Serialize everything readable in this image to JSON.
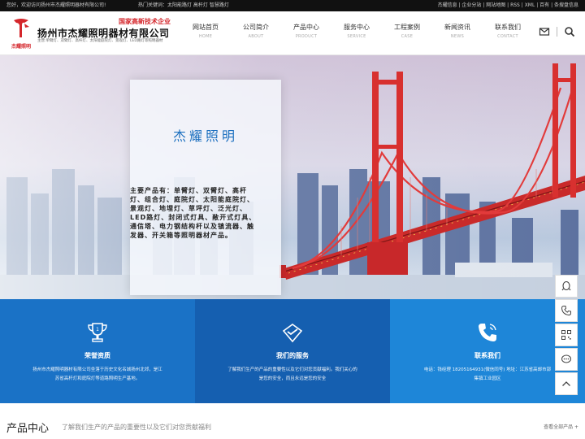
{
  "topbar": {
    "welcome": "您好，欢迎访问扬州市杰耀照明器材有限公司!",
    "hot_keywords": "热门关键词：太阳能路灯  高杆灯  智慧路灯",
    "links": "杰耀信息 | 企业分站 | 网站地图 | RSS | XML | 百有 | 条搜盘信息"
  },
  "header": {
    "logo_brand": "杰耀照明",
    "badge": "国家高新技术企业",
    "company_name": "扬州市杰耀照明器材有限公司",
    "products_line": "主营:单臂灯、双臂灯、高杆灯、太阳能庭院灯、景观灯、LED路灯等照明器材"
  },
  "nav": [
    {
      "cn": "网站首页",
      "en": "HOME"
    },
    {
      "cn": "公司简介",
      "en": "ABOUT"
    },
    {
      "cn": "产品中心",
      "en": "PRODUCT"
    },
    {
      "cn": "服务中心",
      "en": "SERVICE"
    },
    {
      "cn": "工程案例",
      "en": "CASE"
    },
    {
      "cn": "新闻资讯",
      "en": "NEWS"
    },
    {
      "cn": "联系我们",
      "en": "CONTACT"
    }
  ],
  "hero": {
    "title": "杰耀照明",
    "text": "主要产品有：单臂灯、双臂灯、高杆灯、组合灯、庭院灯、太阳能庭院灯、景观灯、地埋灯、草坪灯、泛光灯、LED路灯、封闭式灯具、敞开式灯具、通信塔、电力钢结构杆以及镇流器、触发器、开关箱等照明器材产品。"
  },
  "features": [
    {
      "icon": "trophy-icon",
      "title": "荣誉资质",
      "desc": "扬州市杰耀照明器材有限公司坐落于历史文化名城扬州北郊，是江苏省高杆灯和庭院灯等道路照明生产基地。"
    },
    {
      "icon": "handshake-icon",
      "title": "我们的服务",
      "desc": "了解我们生产的产品的重要性以及它们对您贡献福利。我们关心的是您的安全，而且永远是您的安全"
    },
    {
      "icon": "phone-icon",
      "title": "联系我们",
      "desc": "电话：钱经理 18205164931(微信同号)  地址：江苏省高邮市郭集镇工业园区"
    }
  ],
  "sidebar": [
    "qq-icon",
    "phone-icon",
    "qrcode-icon",
    "message-icon",
    "back-to-top-icon"
  ],
  "section": {
    "title": "产品中心",
    "subtitle": "了解我们生产的产品的重要性以及它们对您贡献福利",
    "more": "查看全部产品 +"
  },
  "colors": {
    "brand_red": "#d4262b",
    "accent_blue": "#1a72c6"
  }
}
